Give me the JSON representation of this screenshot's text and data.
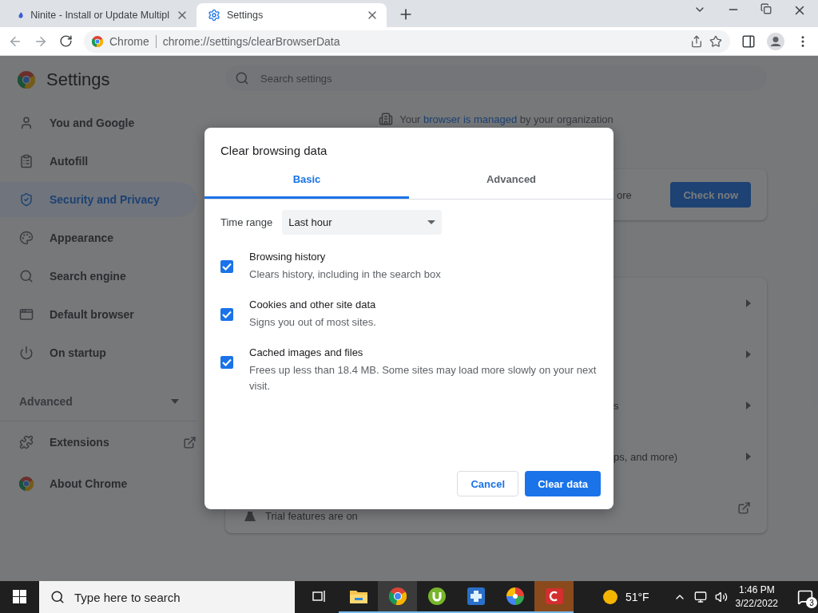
{
  "browser": {
    "tabs": [
      {
        "title": "Ninite - Install or Update Multipl",
        "selected": false,
        "kind": "ninite"
      },
      {
        "title": "Settings",
        "selected": true,
        "kind": "settings"
      }
    ],
    "address": {
      "site_label": "Chrome",
      "url": "chrome://settings/clearBrowserData"
    }
  },
  "settings": {
    "title": "Settings",
    "search": {
      "placeholder": "Search settings"
    },
    "sidebar": {
      "items": [
        {
          "label": "You and Google",
          "kind": "person",
          "selected": false
        },
        {
          "label": "Autofill",
          "kind": "clipboard",
          "selected": false
        },
        {
          "label": "Security and Privacy",
          "kind": "shield",
          "selected": true
        },
        {
          "label": "Appearance",
          "kind": "palette",
          "selected": false
        },
        {
          "label": "Search engine",
          "kind": "search",
          "selected": false
        },
        {
          "label": "Default browser",
          "kind": "window",
          "selected": false
        },
        {
          "label": "On startup",
          "kind": "power",
          "selected": false
        }
      ],
      "advanced": {
        "label": "Advanced",
        "expanded": false
      },
      "extra": [
        {
          "label": "Extensions",
          "kind": "external"
        },
        {
          "label": "About Chrome",
          "kind": "chrome"
        }
      ]
    },
    "managed_notice": {
      "before": "Your ",
      "link": "browser is managed",
      "after": " by your organization"
    },
    "safety_card": {
      "text": "ore",
      "button": "Check now"
    },
    "privacy_rows": [
      {
        "text": "",
        "kind": "arrow"
      },
      {
        "text": "",
        "kind": "arrow"
      },
      {
        "text": "s",
        "kind": "arrow"
      },
      {
        "text": "ps, and more)",
        "kind": "arrow"
      },
      {
        "text": "Trial features are on",
        "kind": "external"
      }
    ]
  },
  "dialog": {
    "title": "Clear browsing data",
    "tabs": [
      {
        "label": "Basic",
        "selected": true
      },
      {
        "label": "Advanced",
        "selected": false
      }
    ],
    "time_range": {
      "label": "Time range",
      "value": "Last hour"
    },
    "options": [
      {
        "title": "Browsing history",
        "description": "Clears history, including in the search box",
        "checked": true
      },
      {
        "title": "Cookies and other site data",
        "description": "Signs you out of most sites.",
        "checked": true
      },
      {
        "title": "Cached images and files",
        "description": "Frees up less than 18.4 MB. Some sites may load more slowly on your next visit.",
        "checked": true
      }
    ],
    "cancel": "Cancel",
    "confirm": "Clear data"
  },
  "taskbar": {
    "search_placeholder": "Type here to search",
    "apps": [
      {
        "kind": "explorer",
        "active": false
      },
      {
        "kind": "chrome",
        "active": true
      },
      {
        "kind": "torrent",
        "active": false
      },
      {
        "kind": "medical",
        "active": false
      },
      {
        "kind": "pinwheel",
        "active": false
      },
      {
        "kind": "letter_c",
        "active": false
      }
    ],
    "weather": "51°F",
    "time": "1:46 PM",
    "date": "3/22/2022",
    "notifications": "3"
  }
}
